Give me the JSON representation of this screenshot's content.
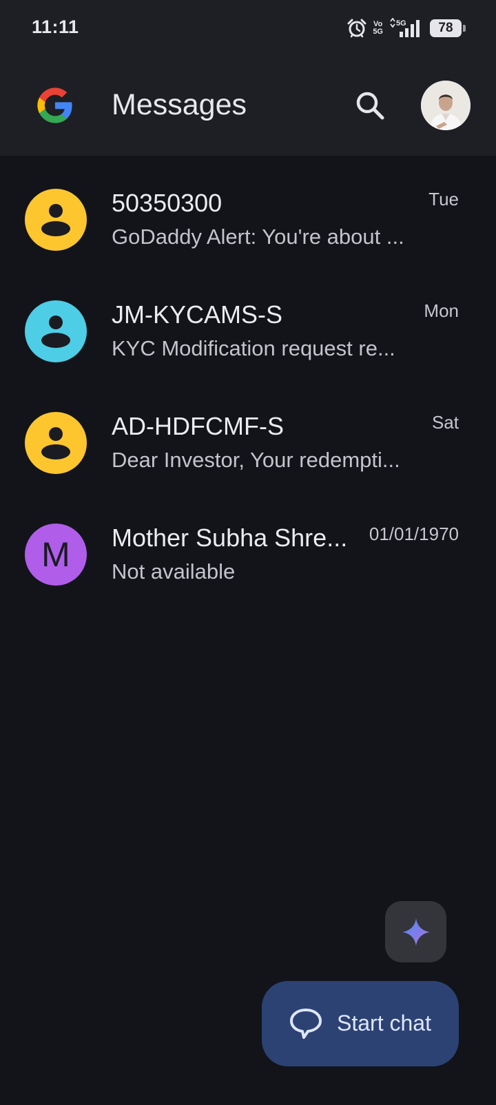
{
  "status_bar": {
    "time": "11:11",
    "volte_top": "Vo",
    "volte_bottom": "5G",
    "network": "5G",
    "battery": "78",
    "icons": [
      "alarm-icon",
      "volte-icon",
      "5g-signal-icon",
      "battery-icon"
    ]
  },
  "app_bar": {
    "title": "Messages",
    "logo": "google-g-logo",
    "search_icon": "search-icon",
    "profile": "account-avatar"
  },
  "conversations": [
    {
      "name": "50350300",
      "snippet": "GoDaddy Alert: You're about ...",
      "date": "Tue",
      "avatar_type": "person-icon",
      "avatar_color": "#fdc62f"
    },
    {
      "name": "JM-KYCAMS-S",
      "snippet": "KYC Modification request re...",
      "date": "Mon",
      "avatar_type": "person-icon",
      "avatar_color": "#4ecde6"
    },
    {
      "name": "AD-HDFCMF-S",
      "snippet": "Dear Investor, Your redempti...",
      "date": "Sat",
      "avatar_type": "person-icon",
      "avatar_color": "#fdc62f"
    },
    {
      "name": "Mother Subha Shre...",
      "snippet": "Not available",
      "date": "01/01/1970",
      "avatar_type": "letter",
      "avatar_letter": "M",
      "avatar_color": "#b05ee9"
    }
  ],
  "gemini_button": {
    "icon": "gemini-sparkle-icon"
  },
  "fab": {
    "label": "Start chat",
    "icon": "chat-bubble-icon"
  },
  "colors": {
    "background": "#12141a",
    "app_bar": "#1d1f25",
    "fab": "#2c4273"
  }
}
